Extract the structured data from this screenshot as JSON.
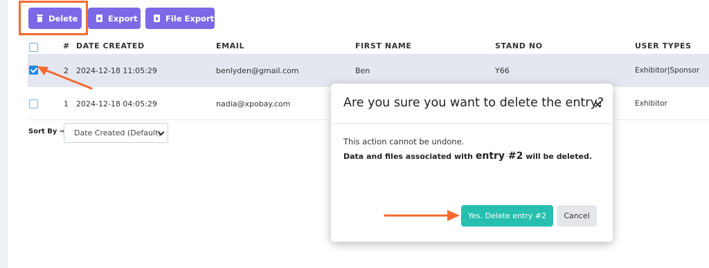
{
  "toolbar": {
    "delete_label": "Delete",
    "export_label": "Export",
    "file_export_label": "File Export",
    "button_color": "#7b69e6"
  },
  "table": {
    "columns": [
      "#",
      "DATE CREATED",
      "EMAIL",
      "FIRST NAME",
      "STAND NO",
      "USER TYPES"
    ],
    "rows": [
      {
        "checked": true,
        "num": "2",
        "date": "2024-12-18 11:05:29",
        "email": "benlyden@gmail.com",
        "first_name": "Ben",
        "stand_no": "Y66",
        "user_types": "Exhibitor|Sponsor"
      },
      {
        "checked": false,
        "num": "1",
        "date": "2024-12-18 04:05:29",
        "email": "nadia@xpobay.com",
        "first_name": "",
        "stand_no": "",
        "user_types": "Exhibitor"
      }
    ]
  },
  "sort": {
    "label": "Sort By →",
    "selected": "Date Created (Default)"
  },
  "modal": {
    "title": "Are you sure you want to delete the entry?",
    "close_glyph": "×",
    "message_line1": "This action cannot be undone.",
    "message_line2_prefix": "Data and files associated with ",
    "message_line2_entry": "entry #2",
    "message_line2_suffix": " will be deleted.",
    "confirm_label": "Yes. Delete entry #2",
    "cancel_label": "Cancel",
    "confirm_color": "#26bfb0"
  },
  "annotations": {
    "highlight_color": "#f26a2f",
    "arrow_color": "#f26a2f"
  }
}
